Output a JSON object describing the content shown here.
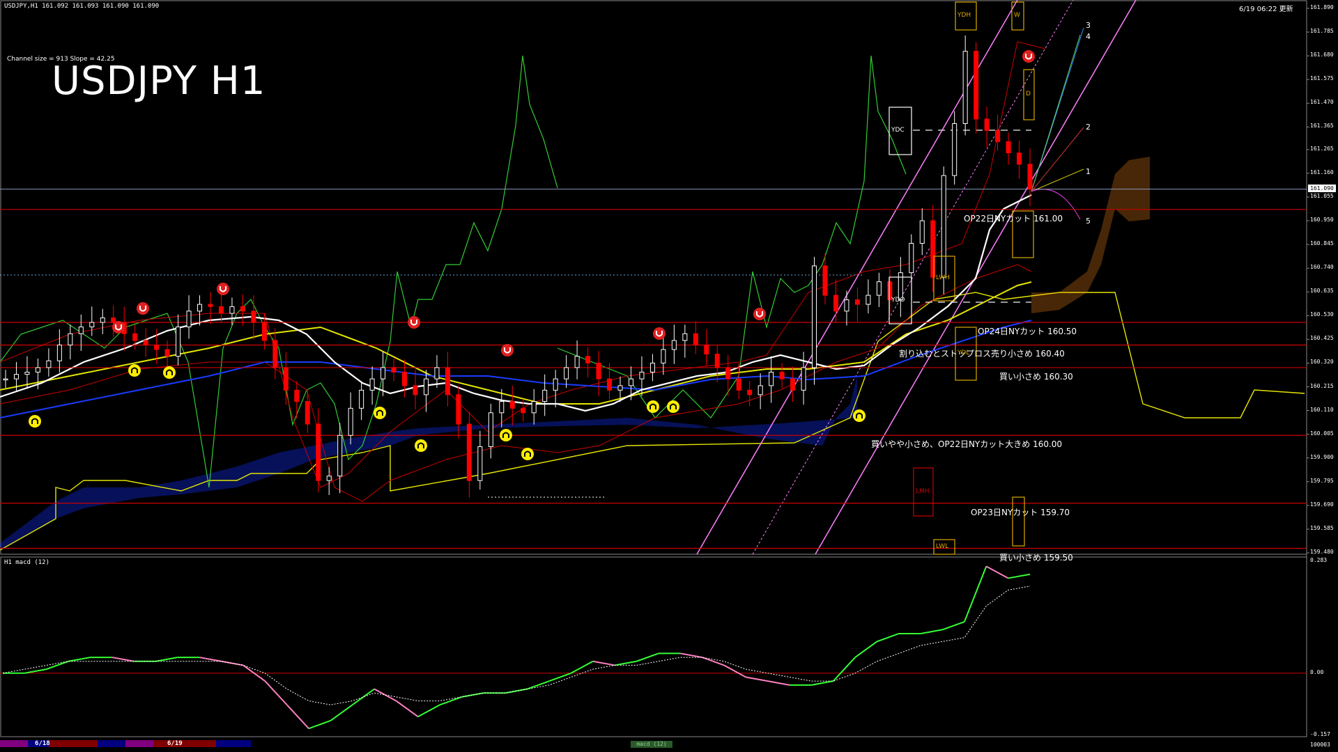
{
  "window": {
    "header_text": "USDJPY,H1  161.092 161.093 161.090 161.090",
    "timestamp": "6/19 06:22 更新",
    "channel_info": "Channel size = 913 Slope = 42.25",
    "big_title": "USDJPY H1"
  },
  "price_axis": {
    "ticks": [
      "161.890",
      "161.785",
      "161.680",
      "161.575",
      "161.470",
      "161.365",
      "161.265",
      "161.160",
      "161.055",
      "160.950",
      "160.845",
      "160.740",
      "160.635",
      "160.530",
      "160.425",
      "160.320",
      "160.215",
      "160.110",
      "160.005",
      "159.900",
      "159.795",
      "159.690",
      "159.585",
      "159.480"
    ],
    "current_price": "161.090"
  },
  "annotations": [
    {
      "text": "OP22日NYカット 161.00"
    },
    {
      "text": "OP24日NYカット 160.50"
    },
    {
      "text": "割り込むとストップロス売り小さめ 160.40"
    },
    {
      "text": "買い小さめ 160.30"
    },
    {
      "text": "買いやや小さめ、OP22日NYカット大きめ 160.00"
    },
    {
      "text": "OP23日NYカット 159.70"
    },
    {
      "text": "買い小さめ 159.50"
    }
  ],
  "box_labels": {
    "ydh": "YDH",
    "ydc": "YDC",
    "ydo": "YDO",
    "ydl": "YDL",
    "lmh": "LMH",
    "lwl": "LWL",
    "d": "D",
    "w": "W",
    "lwh": "LWH"
  },
  "fib_labels": [
    "3",
    "4",
    "2",
    "1",
    "5"
  ],
  "macd_panel": {
    "title": "H1  macd (12)",
    "ticks": [
      "0.283",
      "0.00",
      "-0.157"
    ]
  },
  "bottom_bar": {
    "dates": [
      "6/18",
      "6/19"
    ],
    "bottom_right": "100003",
    "tab_label": "macd (12)"
  },
  "colors": {
    "background": "#000000",
    "candle_up": "#ffffff",
    "candle_down": "#ff0000",
    "level_line": "#cc0000",
    "ichimoku_kumo": "#1a3cff",
    "ichimoku_span_b": "#e6e600",
    "bollinger": "#cc0000",
    "channel": "#ff80ff",
    "rsi_line": "#33cc33",
    "macd_up": "#33ff33",
    "macd_down": "#ff80c0"
  },
  "chart_data": {
    "type": "candlestick",
    "symbol": "USDJPY",
    "timeframe": "H1",
    "ylim": [
      159.48,
      161.89
    ],
    "x_dates": [
      "6/18",
      "6/19"
    ],
    "current_price": 161.09,
    "horizontal_levels": [
      161.0,
      160.5,
      160.4,
      160.3,
      160.0,
      159.7,
      159.5
    ],
    "close_series_approx": [
      160.25,
      160.27,
      160.28,
      160.3,
      160.33,
      160.4,
      160.45,
      160.48,
      160.5,
      160.52,
      160.5,
      160.45,
      160.42,
      160.4,
      160.38,
      160.35,
      160.48,
      160.55,
      160.58,
      160.57,
      160.54,
      160.57,
      160.55,
      160.5,
      160.42,
      160.3,
      160.2,
      160.15,
      160.05,
      159.8,
      159.82,
      160.0,
      160.12,
      160.2,
      160.25,
      160.3,
      160.28,
      160.22,
      160.18,
      160.25,
      160.3,
      160.18,
      160.05,
      159.8,
      159.95,
      160.1,
      160.15,
      160.12,
      160.1,
      160.15,
      160.2,
      160.25,
      160.3,
      160.35,
      160.32,
      160.25,
      160.2,
      160.22,
      160.25,
      160.28,
      160.32,
      160.38,
      160.42,
      160.45,
      160.4,
      160.36,
      160.3,
      160.25,
      160.2,
      160.18,
      160.22,
      160.28,
      160.25,
      160.2,
      160.3,
      160.75,
      160.62,
      160.55,
      160.6,
      160.58,
      160.62,
      160.68,
      160.6,
      160.72,
      160.85,
      160.95,
      160.7,
      161.15,
      161.38,
      161.7,
      161.4,
      161.35,
      161.3,
      161.25,
      161.2,
      161.09
    ],
    "macd": {
      "ylim": [
        -0.157,
        0.283
      ],
      "main_approx": [
        0.0,
        0.0,
        0.01,
        0.03,
        0.04,
        0.04,
        0.03,
        0.03,
        0.04,
        0.04,
        0.03,
        0.02,
        -0.02,
        -0.08,
        -0.14,
        -0.12,
        -0.08,
        -0.04,
        -0.07,
        -0.11,
        -0.08,
        -0.06,
        -0.05,
        -0.05,
        -0.04,
        -0.02,
        0.0,
        0.03,
        0.02,
        0.03,
        0.05,
        0.05,
        0.04,
        0.02,
        -0.01,
        -0.02,
        -0.03,
        -0.03,
        -0.02,
        0.04,
        0.08,
        0.1,
        0.1,
        0.11,
        0.13,
        0.27,
        0.24,
        0.25
      ],
      "signal_approx": [
        0.0,
        0.01,
        0.02,
        0.03,
        0.03,
        0.03,
        0.03,
        0.03,
        0.03,
        0.03,
        0.03,
        0.02,
        0.0,
        -0.04,
        -0.07,
        -0.08,
        -0.07,
        -0.05,
        -0.06,
        -0.07,
        -0.07,
        -0.06,
        -0.05,
        -0.05,
        -0.04,
        -0.03,
        -0.01,
        0.01,
        0.02,
        0.02,
        0.03,
        0.04,
        0.04,
        0.03,
        0.01,
        0.0,
        -0.01,
        -0.02,
        -0.02,
        0.0,
        0.03,
        0.05,
        0.07,
        0.08,
        0.09,
        0.17,
        0.21,
        0.22
      ]
    }
  }
}
